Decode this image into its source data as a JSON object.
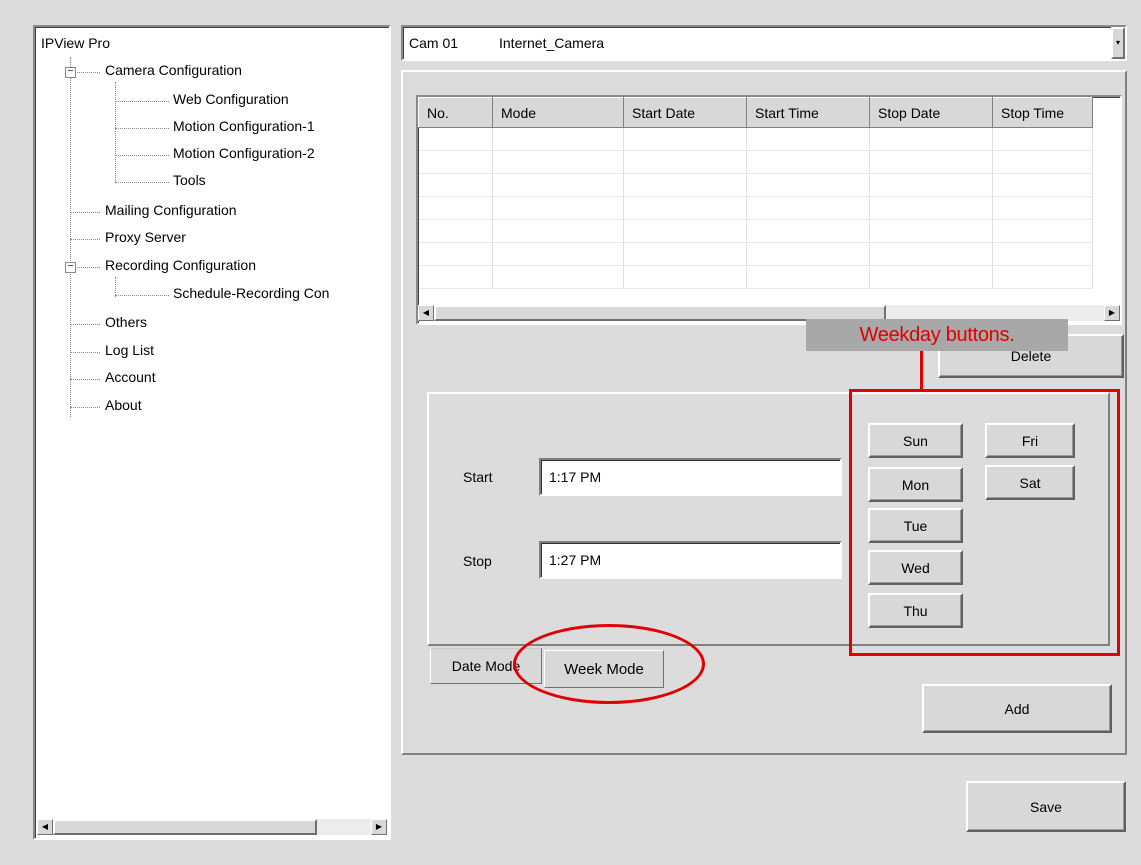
{
  "tree": {
    "root": "IPView Pro",
    "items": [
      {
        "label": "Camera Configuration"
      },
      {
        "label": "Web Configuration"
      },
      {
        "label": "Motion Configuration-1"
      },
      {
        "label": "Motion Configuration-2"
      },
      {
        "label": "Tools"
      },
      {
        "label": "Mailing Configuration"
      },
      {
        "label": "Proxy Server"
      },
      {
        "label": "Recording Configuration"
      },
      {
        "label": "Schedule-Recording Con"
      },
      {
        "label": "Others"
      },
      {
        "label": "Log List"
      },
      {
        "label": "Account"
      },
      {
        "label": "About"
      }
    ],
    "expander_symbol": "−"
  },
  "camera_select": {
    "id": "Cam 01",
    "name": "Internet_Camera"
  },
  "schedule_table": {
    "columns": [
      "No.",
      "Mode",
      "Start Date",
      "Start Time",
      "Stop Date",
      "Stop Time"
    ],
    "rows": []
  },
  "buttons": {
    "delete": "Delete",
    "add": "Add",
    "save": "Save"
  },
  "form": {
    "start_label": "Start",
    "start_value": "1:17 PM",
    "stop_label": "Stop",
    "stop_value": "1:27 PM"
  },
  "weekdays": {
    "sun": "Sun",
    "mon": "Mon",
    "tue": "Tue",
    "wed": "Wed",
    "thu": "Thu",
    "fri": "Fri",
    "sat": "Sat"
  },
  "tabs": {
    "date_mode": "Date Mode",
    "week_mode": "Week Mode"
  },
  "annotation": {
    "callout": "Weekday buttons.",
    "highlight_color": "#e00000"
  }
}
